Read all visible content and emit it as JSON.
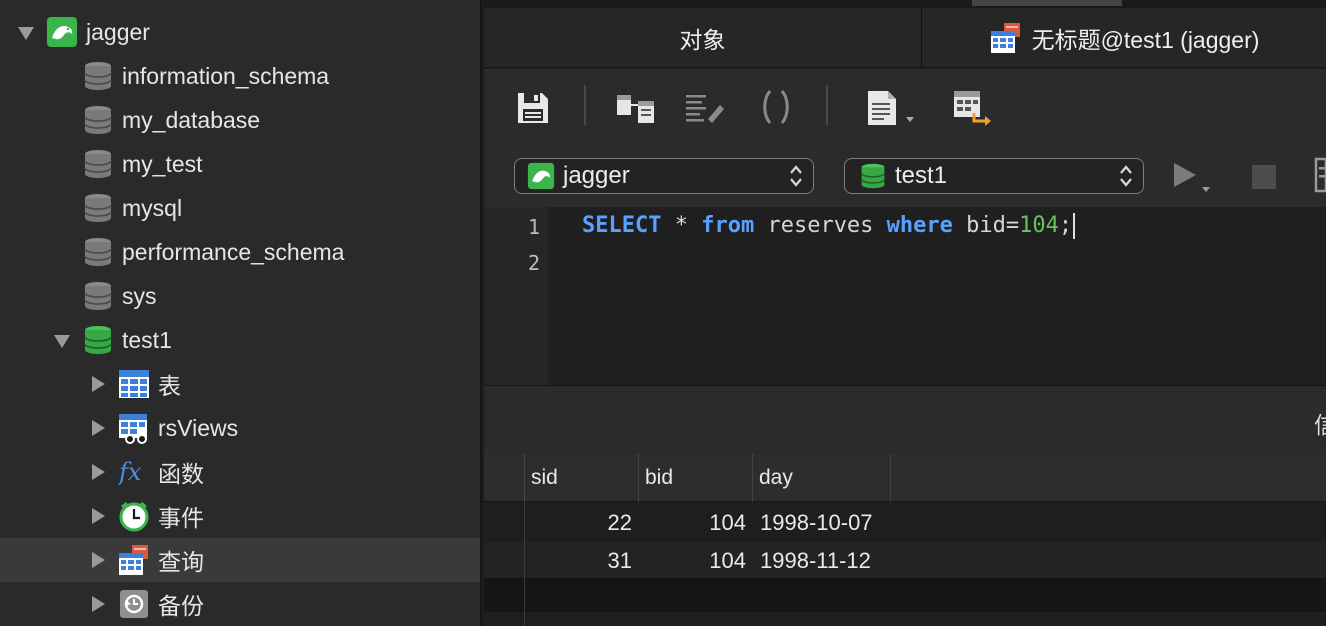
{
  "sidebar": {
    "connection": {
      "label": "jagger"
    },
    "databases": [
      {
        "label": "information_schema"
      },
      {
        "label": "my_database"
      },
      {
        "label": "my_test"
      },
      {
        "label": "mysql"
      },
      {
        "label": "performance_schema"
      },
      {
        "label": "sys"
      }
    ],
    "open_db": {
      "label": "test1"
    },
    "children": [
      {
        "label": "表",
        "icon": "table-grid-icon"
      },
      {
        "label": "rsViews",
        "icon": "view-icon"
      },
      {
        "label": "函数",
        "icon": "function-icon"
      },
      {
        "label": "事件",
        "icon": "clock-icon"
      },
      {
        "label": "查询",
        "icon": "query-icon"
      },
      {
        "label": "备份",
        "icon": "backup-icon"
      }
    ]
  },
  "tabs": {
    "objects_label": "对象",
    "query_label": "无标题@test1 (jagger)"
  },
  "selectors": {
    "connection_value": "jagger",
    "database_value": "test1"
  },
  "editor": {
    "line_numbers": [
      "1",
      "2"
    ],
    "sql": {
      "kw_select": "SELECT",
      "star": " * ",
      "kw_from": "from",
      "table": " reserves ",
      "kw_where": "where",
      "cond": " bid=",
      "value": "104",
      "end": ";"
    }
  },
  "result_panel": {
    "info_glyph": "信"
  },
  "grid": {
    "columns": [
      "sid",
      "bid",
      "day"
    ],
    "rows": [
      {
        "sid": "22",
        "bid": "104",
        "day": "1998-10-07"
      },
      {
        "sid": "31",
        "bid": "104",
        "day": "1998-11-12"
      }
    ]
  },
  "colors": {
    "keyword": "#5aa0ff",
    "number": "#67c45d",
    "mysql_green": "#3bb54a",
    "db_gray": "#8a8a8a"
  }
}
